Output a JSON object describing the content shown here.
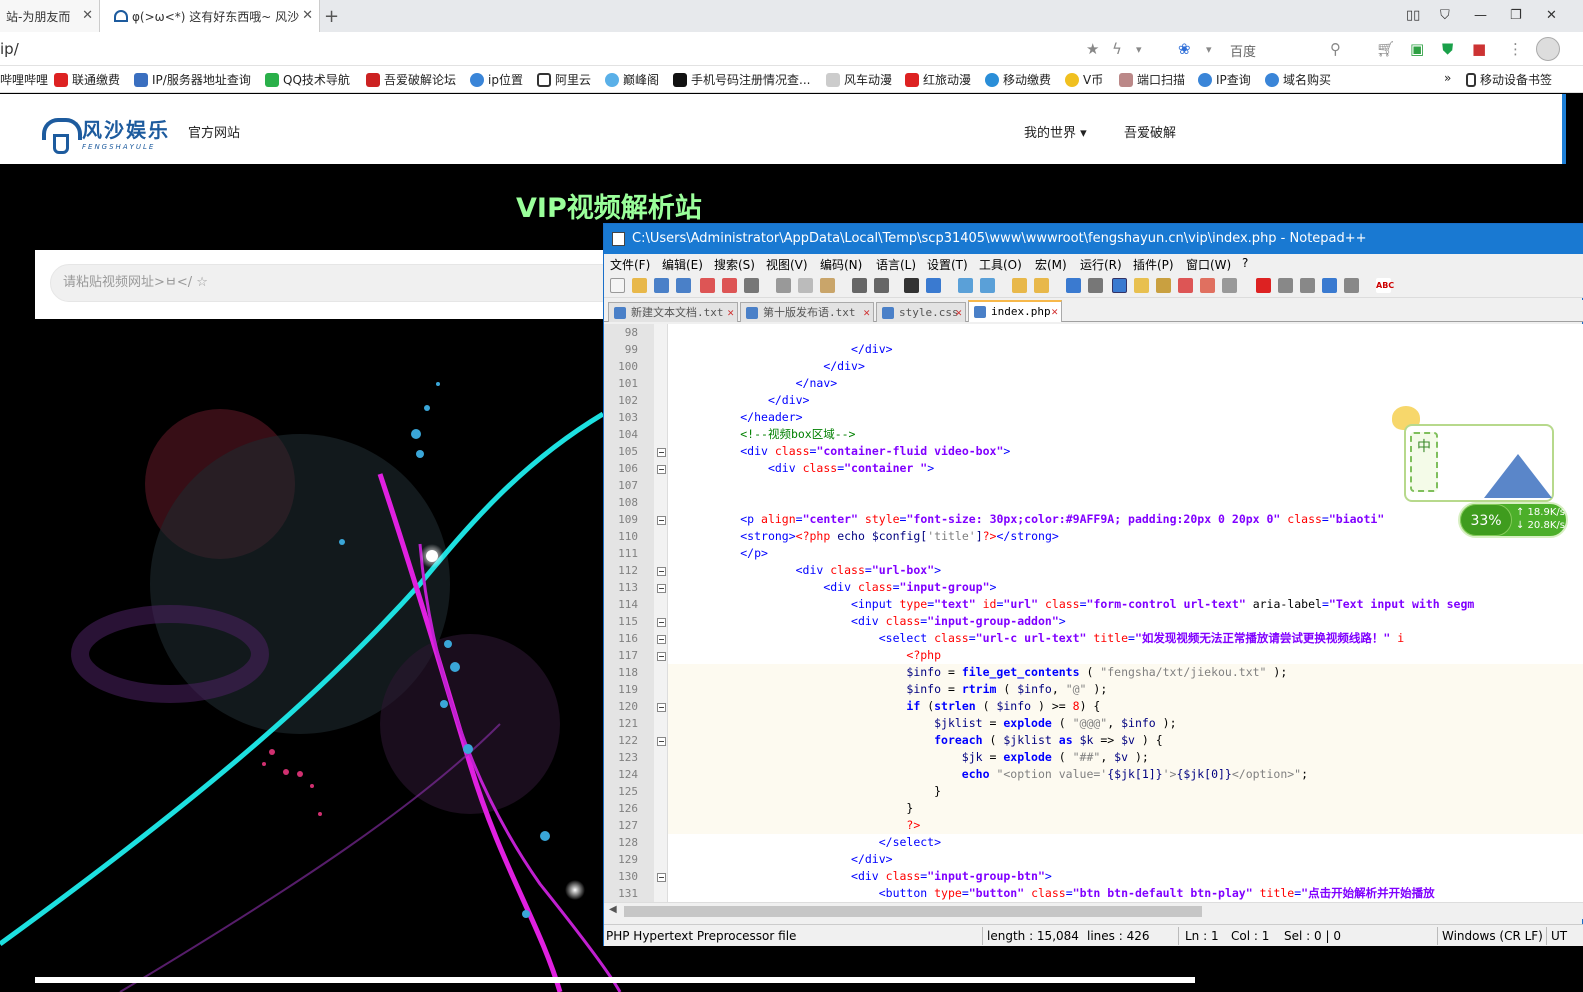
{
  "browser": {
    "tabs": [
      {
        "title": "站-为朋友而"
      },
      {
        "title": "φ(>ω<*) 这有好东西哦~ 风沙"
      }
    ],
    "address": "ip/",
    "search_engine": "百度",
    "bookmarks": [
      "哔哩哔哩",
      "联通缴费",
      "IP/服务器地址查询",
      "QQ技术导航",
      "吾爱破解论坛",
      "ip位置",
      "阿里云",
      "巅峰阁",
      "手机号码注册情况查...",
      "风车动漫",
      "红旅动漫",
      "移动缴费",
      "V币",
      "端口扫描",
      "IP查询",
      "域名购买"
    ],
    "bookmarks_more": "»",
    "mobile_bookmarks": "移动设备书签"
  },
  "site": {
    "logo_main": "风沙娱乐",
    "logo_sub": "FENGSHAYULE",
    "official": "官方网站",
    "nav": [
      "我的世界 ▾",
      "吾爱破解"
    ],
    "title": "VIP视频解析站",
    "url_placeholder": "请粘贴视频网址>ㅂ</ ☆"
  },
  "notepad": {
    "title": "C:\\Users\\Administrator\\AppData\\Local\\Temp\\scp31405\\www\\wwwroot\\fengshayun.cn\\vip\\index.php - Notepad++",
    "menu": [
      "文件(F)",
      "编辑(E)",
      "搜索(S)",
      "视图(V)",
      "编码(N)",
      "语言(L)",
      "设置(T)",
      "工具(O)",
      "宏(M)",
      "运行(R)",
      "插件(P)",
      "窗口(W)",
      "?"
    ],
    "tabs": [
      "新建文本文档.txt",
      "第十版发布语.txt",
      "style.css",
      "index.php"
    ],
    "lines": [
      "98",
      "99",
      "100",
      "101",
      "102",
      "103",
      "104",
      "105",
      "106",
      "107",
      "108",
      "109",
      "110",
      "111",
      "112",
      "113",
      "114",
      "115",
      "116",
      "117",
      "118",
      "119",
      "120",
      "121",
      "122",
      "123",
      "124",
      "125",
      "126",
      "127",
      "128",
      "129",
      "130",
      "131"
    ],
    "status": {
      "filetype": "PHP Hypertext Preprocessor file",
      "length": "length : 15,084",
      "lines": "lines : 426",
      "ln": "Ln : 1",
      "col": "Col : 1",
      "sel": "Sel : 0 | 0",
      "eol": "Windows (CR LF)",
      "enc": "UT"
    }
  },
  "widget": {
    "char": "中",
    "percent": "33%",
    "up": "↑ 18.9K/s",
    "down": "↓ 20.8K/s"
  },
  "colors": {
    "title_green": "#9AFF9A",
    "npp_title": "#1979d2",
    "logo_blue": "#1d5b9e"
  }
}
